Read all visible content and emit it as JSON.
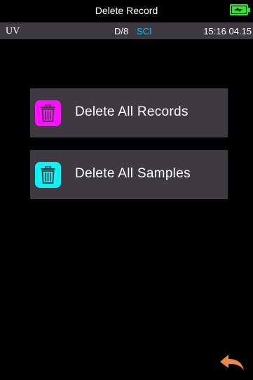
{
  "title_bar": {
    "title": "Delete Record",
    "battery_color": "#2ee52e"
  },
  "status_bar": {
    "mode": "UV",
    "geometry": "D/8",
    "spec_mode": "SCI",
    "time": "15:16 04.15",
    "spec_color": "#18c0e8",
    "background": "#3f3a42"
  },
  "menu": {
    "items": [
      {
        "label": "Delete All Records",
        "icon": "trash-icon",
        "icon_color": "#ff10ff"
      },
      {
        "label": "Delete All Samples",
        "icon": "trash-icon",
        "icon_color": "#12f0f4"
      }
    ]
  },
  "bottom_bar": {
    "back_icon": "back-arrow-icon",
    "back_icon_color": "#e98a4a"
  }
}
